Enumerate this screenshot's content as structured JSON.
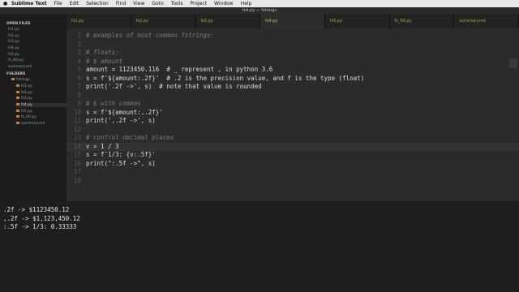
{
  "menubar": {
    "apple": "",
    "items": [
      "Sublime Text",
      "File",
      "Edit",
      "Selection",
      "Find",
      "View",
      "Goto",
      "Tools",
      "Project",
      "Window",
      "Help"
    ]
  },
  "window": {
    "title": "fs4.py — fstrings"
  },
  "tabs": [
    "fs1.py",
    "fs2.py",
    "fs3.py",
    "fs4.py",
    "fs5.py",
    "fs_60.py",
    "summary.md"
  ],
  "sidebar": {
    "open_files_header": "OPEN FILES",
    "open_files": [
      "fs1.py",
      "fs2.py",
      "fs3.py",
      "fs4.py",
      "fs5.py",
      "fs_60.py",
      "summary.md"
    ],
    "folders_header": "FOLDERS",
    "folder_name": "fstrings",
    "folder_files": [
      "fs1.py",
      "fs2.py",
      "fs3.py",
      "fs4.py",
      "fs5.py",
      "fs_60.py",
      "summary.md"
    ]
  },
  "editor": {
    "line_numbers": [
      "1",
      "2",
      "3",
      "4",
      "5",
      "6",
      "7",
      "8",
      "9",
      "10",
      "11",
      "12",
      "13",
      "14",
      "15",
      "16",
      "17",
      "18"
    ],
    "lines": [
      "# examples of most common fstrings:",
      "",
      "# floats:",
      "# $ amount",
      "amount = 1123450.116  # _ represent , in python 3.6",
      "s = f'${amount:.2f}'  # .2 is the precision value, and f is the type (float)",
      "print('.2f ->', s)  # note that value is rounded",
      "",
      "# $ with commas",
      "s = f'${amount:,.2f}'",
      "print(',.2f ->', s)",
      "",
      "# control decimal places",
      "v = 1 / 3",
      "s = f'1/3: {v:.5f}'",
      "print(\":.5f ->\", s)",
      "",
      ""
    ]
  },
  "console": {
    "lines": [
      ".2f -> $1123450.12",
      ",.2f -> $1,123,450.12",
      ":.5f -> 1/3: 0.33333"
    ]
  }
}
